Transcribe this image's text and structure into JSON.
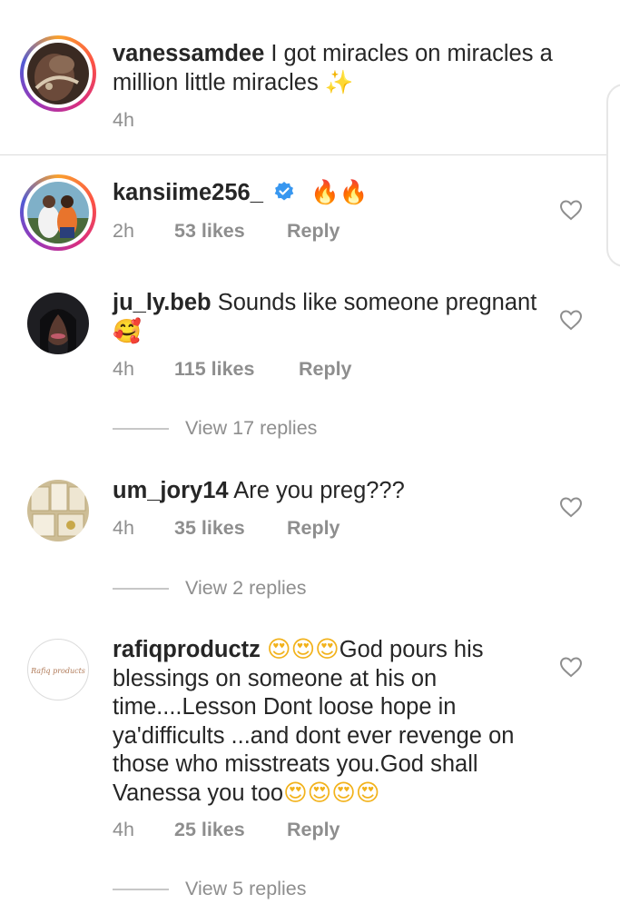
{
  "caption": {
    "username": "vanessamdee",
    "text": "I got miracles on miracles a million little miracles",
    "emoji": "✨",
    "time": "4h"
  },
  "comments": [
    {
      "username": "kansiime256_",
      "verified": true,
      "text": "",
      "emoji": "🔥🔥",
      "time": "2h",
      "likes": "53 likes",
      "reply": "Reply",
      "view_replies": ""
    },
    {
      "username": "ju_ly.beb",
      "text": "Sounds like someone pregnant",
      "emoji": "🥰",
      "time": "4h",
      "likes": "115 likes",
      "reply": "Reply",
      "view_replies": "View 17 replies"
    },
    {
      "username": "um_jory14",
      "text": "Are you preg???",
      "emoji": "",
      "time": "4h",
      "likes": "35 likes",
      "reply": "Reply",
      "view_replies": "View 2 replies"
    },
    {
      "username": "rafiqproductz",
      "text_before_emoji": "😍😍😍",
      "text": "God pours his blessings on someone at his on time....Lesson Dont loose hope in ya'difficults ...and dont ever  revenge on those who misstreats you.God shall Vanessa you too",
      "emoji": "😍😍😍😍",
      "avatar_label": "Rafiq products",
      "time": "4h",
      "likes": "25 likes",
      "reply": "Reply",
      "view_replies": "View 5 replies"
    }
  ],
  "colors": {
    "text": "#262626",
    "secondary": "#8e8e8e",
    "verified": "#3897f0",
    "divider": "#dbdbdb"
  },
  "icons": {
    "heart": "heart-outline-icon",
    "verified": "verified-badge-icon"
  }
}
